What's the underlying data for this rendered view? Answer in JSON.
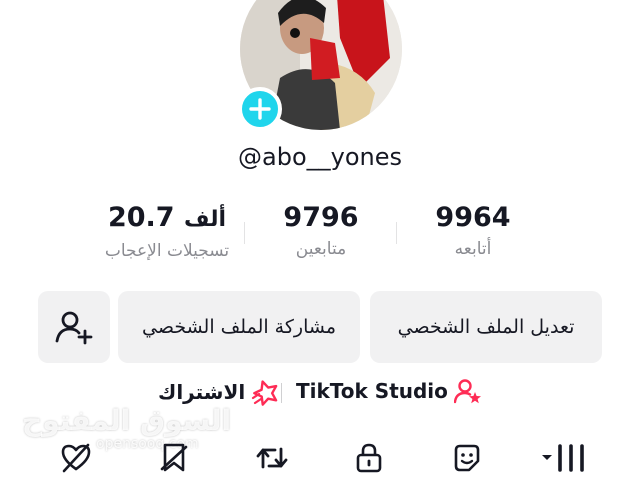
{
  "profile": {
    "username": "@abo__yones"
  },
  "stats": [
    {
      "value": "9964",
      "label": "أتابعه"
    },
    {
      "value": "9796",
      "label": "متابعين"
    },
    {
      "value": "20.7",
      "unit": "ألف",
      "label": "تسجيلات الإعجاب"
    }
  ],
  "actions": {
    "edit_profile": "تعديل الملف الشخصي",
    "share_profile": "مشاركة الملف الشخصي"
  },
  "links": {
    "studio": "TikTok Studio",
    "subscription": "الاشتراك"
  },
  "watermark": {
    "arabic": "السوق المفتوح",
    "latin": "opensooq.com"
  },
  "tabs": [
    {
      "icon": "liked-videos-hidden-icon"
    },
    {
      "icon": "favorites-hidden-icon"
    },
    {
      "icon": "reposts-icon"
    },
    {
      "icon": "private-lock-icon"
    },
    {
      "icon": "stickers-icon"
    },
    {
      "icon": "videos-grid-icon",
      "selected": true
    }
  ],
  "colors": {
    "accent_cyan": "#20d5ec",
    "accent_pink": "#fe2c55",
    "button_bg": "#f1f1f2",
    "secondary_text": "#8a8b91"
  }
}
